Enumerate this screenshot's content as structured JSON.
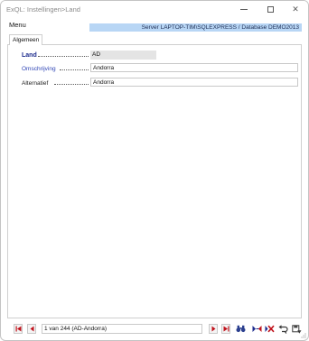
{
  "window": {
    "title": "ExQL: Instellingen>Land"
  },
  "menu": {
    "label": "Menu"
  },
  "server_info": "Server LAPTOP-TIM\\SQLEXPRESS / Database DEMO2013",
  "tabs": [
    {
      "label": "Algemeen"
    }
  ],
  "form": {
    "land": {
      "label": "Land",
      "value": "AD"
    },
    "omschrijving": {
      "label": "Omschrijving",
      "value": "Andorra"
    },
    "alternatief": {
      "label": "Alternatief",
      "value": "Andorra"
    }
  },
  "navigation": {
    "record_status": "1 van 244 (AD-Andorra)",
    "buttons": [
      {
        "icon": "first-record-icon"
      },
      {
        "icon": "previous-record-icon"
      },
      {
        "icon": "next-record-icon"
      },
      {
        "icon": "last-record-icon"
      },
      {
        "icon": "search-binoculars-icon"
      },
      {
        "icon": "new-record-icon"
      },
      {
        "icon": "delete-record-icon"
      },
      {
        "icon": "undo-icon"
      },
      {
        "icon": "save-icon"
      }
    ]
  },
  "colors": {
    "server_bar": "#b8d6f5",
    "primary_label": "#1b2a8c",
    "secondary_label": "#2f45b5",
    "nav_arrow": "#c0121c",
    "readonly_field": "#e4e4e4"
  }
}
